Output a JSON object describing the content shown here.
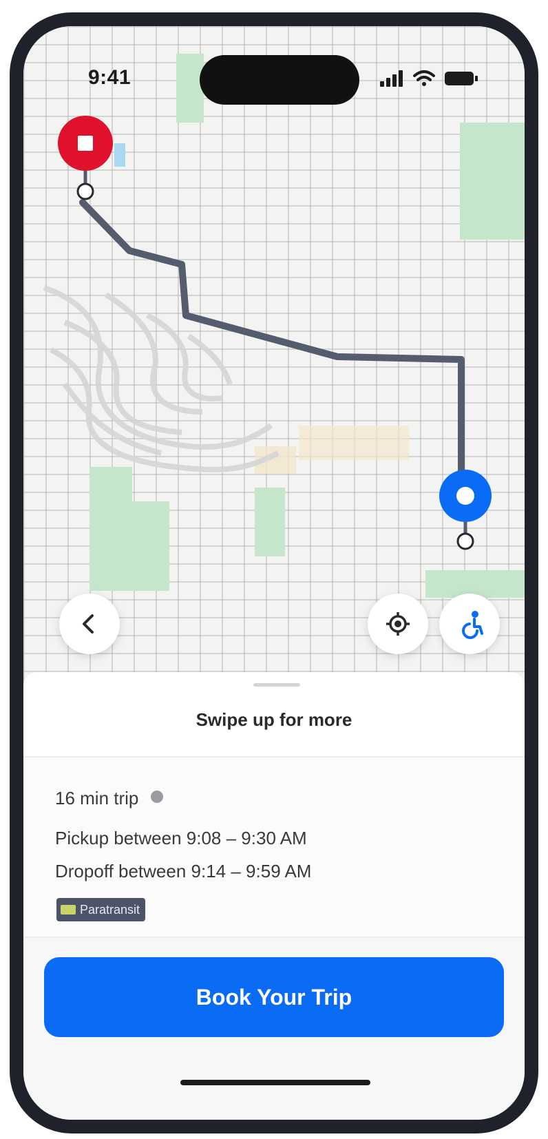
{
  "status_bar": {
    "time": "9:41",
    "icons": [
      "cellular-signal-icon",
      "wifi-icon",
      "battery-icon"
    ]
  },
  "map": {
    "markers": [
      {
        "name": "dropoff-marker",
        "icon": "stop-square-icon",
        "color": "#e0112b"
      },
      {
        "name": "pickup-marker",
        "icon": "dot-icon",
        "color": "#0a6cf5"
      }
    ],
    "route_color": "#555c6e",
    "park_color": "#bfe3c4"
  },
  "map_controls": {
    "back_icon": "chevron-left-icon",
    "locate_icon": "crosshair-icon",
    "accessibility_icon": "wheelchair-icon"
  },
  "sheet": {
    "hint": "Swipe up for more",
    "trip_duration": "16 min trip",
    "pickup": "Pickup between 9:08 – 9:30 AM",
    "dropoff": "Dropoff between 9:14 – 9:59 AM",
    "badge_label": "Paratransit",
    "book_button": "Book Your Trip"
  },
  "colors": {
    "accent": "#0a6cf5",
    "destination": "#e0112b",
    "frame": "#1f222b"
  }
}
